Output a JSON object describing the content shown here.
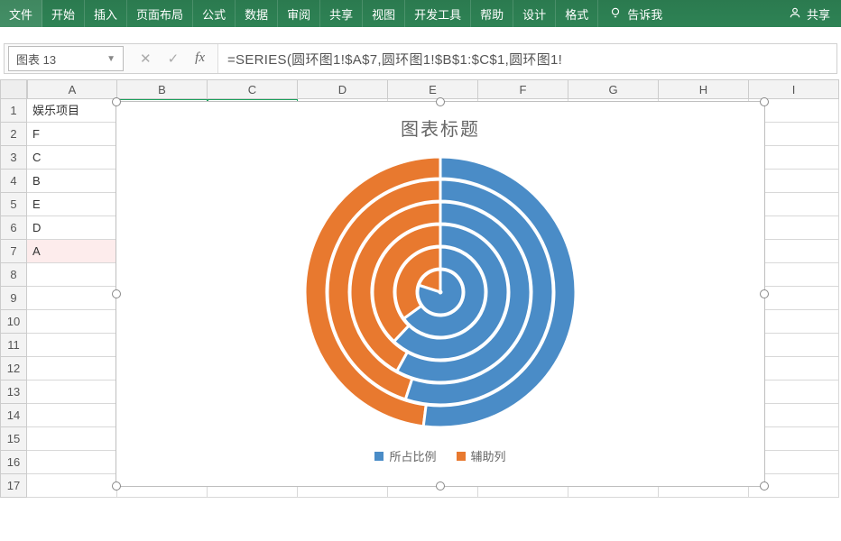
{
  "ribbon": {
    "tabs": [
      "文件",
      "开始",
      "插入",
      "页面布局",
      "公式",
      "数据",
      "审阅",
      "共享",
      "视图",
      "开发工具",
      "帮助",
      "设计",
      "格式"
    ],
    "tell_me": "告诉我",
    "share": "共享"
  },
  "namebox": {
    "value": "图表 13"
  },
  "formula_bar": {
    "cancel": "✕",
    "enter": "✓",
    "fx": "fx",
    "formula": "=SERIES(圆环图1!$A$7,圆环图1!$B$1:$C$1,圆环图1!"
  },
  "columns": [
    "A",
    "B",
    "C",
    "D",
    "E",
    "F",
    "G",
    "H",
    "I"
  ],
  "row_numbers": [
    "1",
    "2",
    "3",
    "4",
    "5",
    "6",
    "7",
    "8",
    "9",
    "10",
    "11",
    "12",
    "13",
    "14",
    "15",
    "16",
    "17"
  ],
  "table": {
    "headers": {
      "a": "娱乐项目",
      "b": "所占比例",
      "c": "辅助列"
    },
    "rows": [
      "F",
      "C",
      "B",
      "E",
      "D",
      "A"
    ]
  },
  "chart": {
    "title": "图表标题",
    "legend": {
      "s1": "所占比例",
      "s2": "辅助列"
    }
  },
  "colors": {
    "blue": "#4a8cc7",
    "orange": "#e8792f",
    "gap": "#ffffff"
  },
  "chart_data": {
    "type": "pie",
    "subtype": "multi-ring-doughnut",
    "title": "图表标题",
    "categories": [
      "F",
      "C",
      "B",
      "E",
      "D",
      "A"
    ],
    "series": [
      {
        "name": "所占比例",
        "values": [
          0.48,
          0.45,
          0.42,
          0.38,
          0.35,
          0.2
        ],
        "color": "#e8792f"
      },
      {
        "name": "辅助列",
        "values": [
          0.52,
          0.55,
          0.58,
          0.62,
          0.65,
          0.8
        ],
        "color": "#4a8cc7"
      }
    ],
    "note": "Each category is one concentric ring (outer→inner = F,C,B,E,D,A). Each ring is split into 所占比例 (orange) + 辅助列 (blue) summing to 1.0. Values estimated from arc angles; innermost ring (A) is highlighted/selected."
  }
}
